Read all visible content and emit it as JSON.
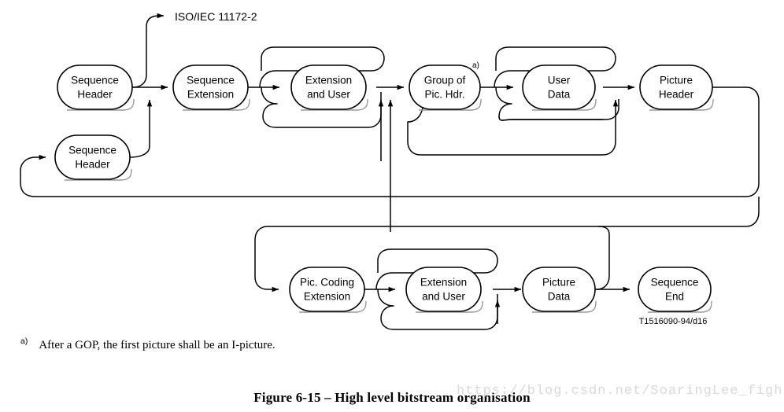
{
  "figure": {
    "caption": "Figure 6-15 – High level bitstream organisation",
    "figure_id": "T1516090-94/d16",
    "external_ref_label": "ISO/IEC 11172-2",
    "footnote_mark": "a)",
    "footnote_text": "After a GOP, the first picture shall be an I-picture.",
    "node_footnote_mark": "a)",
    "watermark": "https://blog.csdn.net/SoaringLee_fighting",
    "colors": {
      "stroke": "#000000",
      "shadow": "#9a9a9a",
      "background": "#ffffff",
      "watermark": "#d9d9d9"
    }
  },
  "nodes": [
    {
      "id": "sequence-header-1",
      "line1": "Sequence",
      "line2": "Header"
    },
    {
      "id": "sequence-header-2",
      "line1": "Sequence",
      "line2": "Header"
    },
    {
      "id": "sequence-extension",
      "line1": "Sequence",
      "line2": "Extension"
    },
    {
      "id": "extension-and-user-1",
      "line1": "Extension",
      "line2": "and User"
    },
    {
      "id": "group-of-pic-hdr",
      "line1": "Group of",
      "line2": "Pic. Hdr."
    },
    {
      "id": "user-data",
      "line1": "User",
      "line2": "Data"
    },
    {
      "id": "picture-header",
      "line1": "Picture",
      "line2": "Header"
    },
    {
      "id": "pic-coding-extension",
      "line1": "Pic. Coding",
      "line2": "Extension"
    },
    {
      "id": "extension-and-user-2",
      "line1": "Extension",
      "line2": "and User"
    },
    {
      "id": "picture-data",
      "line1": "Picture",
      "line2": "Data"
    },
    {
      "id": "sequence-end",
      "line1": "Sequence",
      "line2": "End"
    }
  ]
}
